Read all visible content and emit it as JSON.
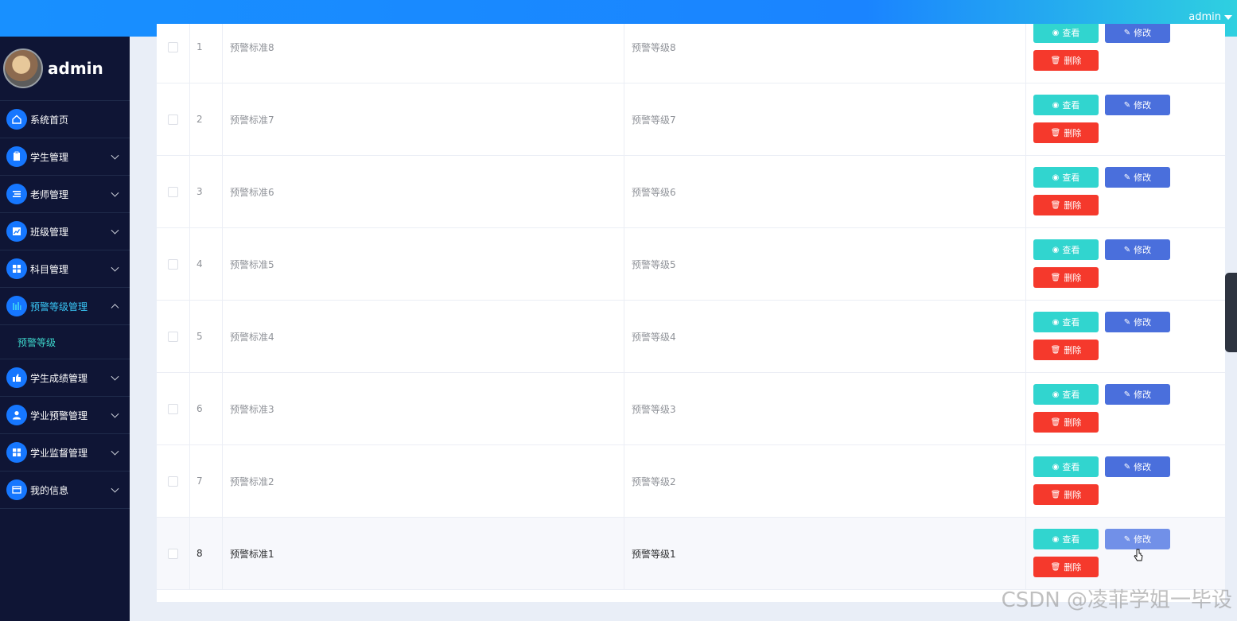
{
  "header": {
    "user": "admin"
  },
  "profile": {
    "name": "admin"
  },
  "sidebar": {
    "items": [
      {
        "label": "系统首页",
        "icon": "home-icon"
      },
      {
        "label": "学生管理",
        "icon": "clipboard-icon"
      },
      {
        "label": "老师管理",
        "icon": "list-icon"
      },
      {
        "label": "班级管理",
        "icon": "chart-icon"
      },
      {
        "label": "科目管理",
        "icon": "grid-icon"
      },
      {
        "label": "预警等级管理",
        "icon": "bars-icon"
      },
      {
        "label": "学生成绩管理",
        "icon": "thumb-icon"
      },
      {
        "label": "学业预警管理",
        "icon": "user-icon"
      },
      {
        "label": "学业监督管理",
        "icon": "grid-icon"
      },
      {
        "label": "我的信息",
        "icon": "card-icon"
      }
    ],
    "submenu": {
      "label": "预警等级"
    }
  },
  "table": {
    "rows": [
      {
        "index": "1",
        "standard": "预警标准8",
        "level": "预警等级8"
      },
      {
        "index": "2",
        "standard": "预警标准7",
        "level": "预警等级7"
      },
      {
        "index": "3",
        "standard": "预警标准6",
        "level": "预警等级6"
      },
      {
        "index": "4",
        "standard": "预警标准5",
        "level": "预警等级5"
      },
      {
        "index": "5",
        "standard": "预警标准4",
        "level": "预警等级4"
      },
      {
        "index": "6",
        "standard": "预警标准3",
        "level": "预警等级3"
      },
      {
        "index": "7",
        "standard": "预警标准2",
        "level": "预警等级2"
      },
      {
        "index": "8",
        "standard": "预警标准1",
        "level": "预警等级1"
      }
    ],
    "actions": {
      "view": "查看",
      "edit": "修改",
      "delete": "删除"
    }
  },
  "watermark": "CSDN @凌菲学姐一毕设",
  "colors": {
    "accent": "#1890ff",
    "view": "#31d5cf",
    "edit": "#4a6fdc",
    "delete": "#f5392c",
    "sidebar": "#0f1535"
  }
}
